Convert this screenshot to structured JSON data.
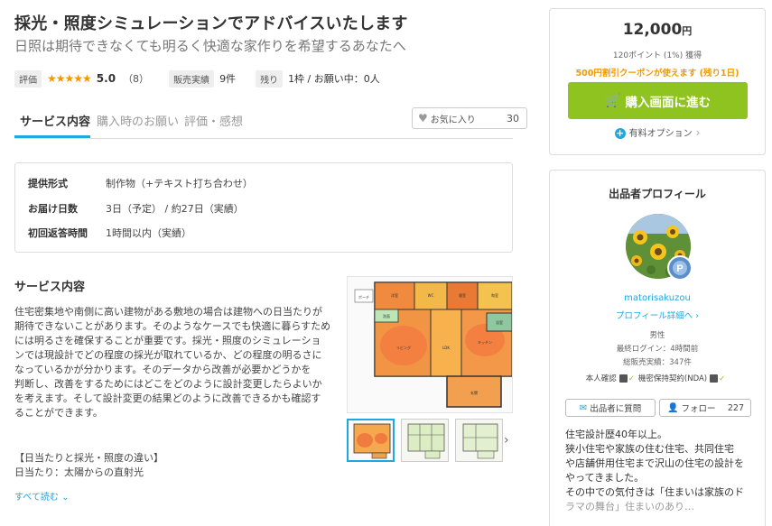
{
  "title": "採光・照度シミュレーションでアドバイスいたします",
  "subtitle": "日照は期待できなくても明るく快適な家作りを希望するあなたへ",
  "meta": {
    "rating_tag": "評価",
    "stars": "★★★★★",
    "score": "5.0",
    "review_count": "（8）",
    "sales_tag": "販売実績",
    "sales_value": "9件",
    "remaining_tag": "残り",
    "remaining_value": "1枠 / お願い中：0人"
  },
  "tabs": [
    "サービス内容",
    "購入時のお願い",
    "評価・感想"
  ],
  "favorite": {
    "label": "お気に入り",
    "count": "30"
  },
  "info": [
    {
      "label": "提供形式",
      "value": "制作物（+テキスト打ち合わせ）"
    },
    {
      "label": "お届け日数",
      "value": "3日（予定） / 約27日（実績）"
    },
    {
      "label": "初回返答時間",
      "value": "1時間以内（実績）"
    }
  ],
  "service": {
    "heading": "サービス内容",
    "paragraphs": [
      "住宅密集地や南側に高い建物がある敷地の場合は建物への日当たりが",
      "期待できないことがあります。そのようなケースでも快適に暮らすため",
      "には明るさを確保することが重要です。採光・照度のシミュレーショ",
      "ンでは現設計でどの程度の採光が取れているか、どの程度の明るさに",
      "なっているかが分かります。そのデータから改善が必要かどうかを",
      "判断し、改善をするためにはどこをどのように設計変更したらよいか",
      "を考えます。そして設計変更の結果どのように改善できるかも確認す",
      "ることができます。"
    ],
    "section_title": "【日当たりと採光・照度の違い】",
    "section_line": "日当たり：太陽からの直射光",
    "read_more": "すべて読む"
  },
  "plan_labels": [
    "ポーチ",
    "LDK",
    "リビング",
    "キッチン",
    "洋室",
    "和室",
    "浴室",
    "洗面",
    "WC",
    "玄関",
    "寝室"
  ],
  "purchase": {
    "price": "12,000",
    "yen": "円",
    "points": "120ポイント (1%) 獲得",
    "coupon": "500円割引クーポンが使えます (残り1日)",
    "buy_label": "購入画面に進む",
    "options_label": "有料オプション"
  },
  "profile": {
    "heading": "出品者プロフィール",
    "username": "matorisakuzou",
    "detail_link": "プロフィール詳細へ",
    "gender": "男性",
    "last_login": "最終ログイン：4時間前",
    "total_sales": "総販売実績：347件",
    "identity": "本人確認",
    "nda": "機密保持契約(NDA)",
    "ask_label": "出品者に質問",
    "follow_label": "フォロー",
    "follow_count": "227",
    "bio": [
      "住宅設計歴40年以上。",
      "狭小住宅や家族の住む住宅、共同住宅",
      "や店舗併用住宅まで沢山の住宅の設計を",
      "やってきました。",
      "その中での気付きは「住まいは家族のド",
      "ラマの舞台」住まいのあり…"
    ]
  },
  "colors": {
    "accent_blue": "#1ea7e1",
    "buy_green": "#8fc31f",
    "coupon_orange": "#f39800",
    "star_orange": "#f39800"
  }
}
